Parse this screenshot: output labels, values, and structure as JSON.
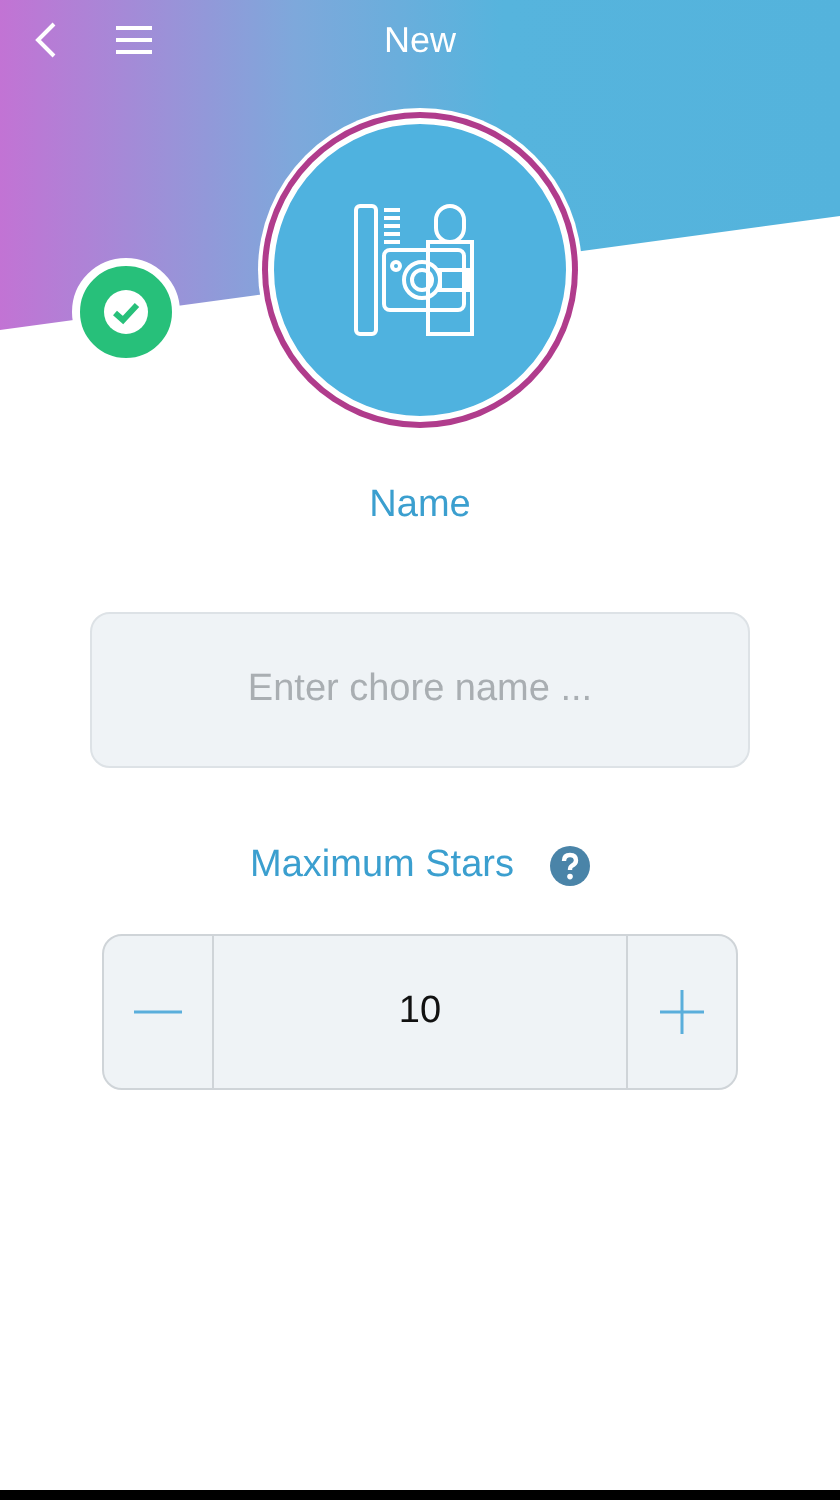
{
  "nav_bar": {
    "title": "New"
  },
  "name_section": {
    "label": "Name",
    "field": {
      "placeholder": "Enter chore name ..."
    }
  },
  "stars_section": {
    "label": "Maximum Stars",
    "stepper": {
      "value": "10"
    }
  }
}
